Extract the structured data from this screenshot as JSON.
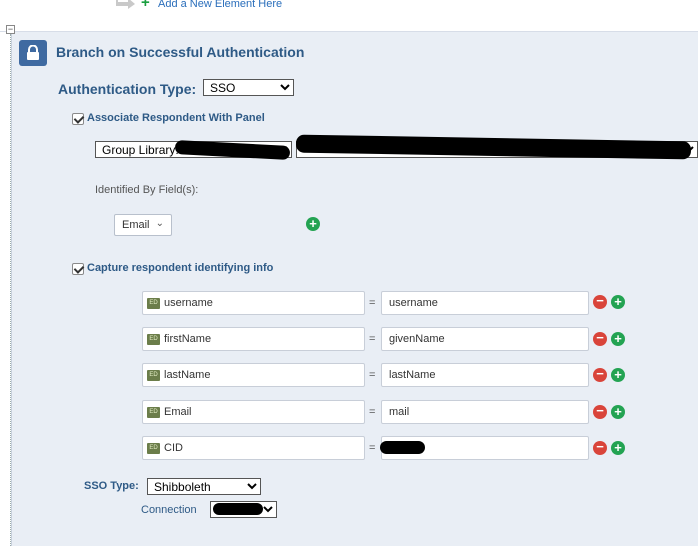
{
  "top": {
    "add_element_label": "Add a New Element Here"
  },
  "collapse_glyph": "−",
  "branch": {
    "title": "Branch on Successful Authentication",
    "auth_type_label": "Authentication Type:",
    "auth_type_value": "SSO",
    "associate_label": "Associate Respondent With Panel",
    "associate_checked": true,
    "group_library_text": "Group Library:",
    "identified_label": "Identified By Field(s):",
    "identified_field": "Email",
    "capture_label": "Capture respondent identifying info",
    "capture_checked": true,
    "mappings": [
      {
        "left": "username",
        "right": "username"
      },
      {
        "left": "firstName",
        "right": "givenName"
      },
      {
        "left": "lastName",
        "right": "lastName"
      },
      {
        "left": "Email",
        "right": "mail"
      },
      {
        "left": "CID",
        "right": ""
      }
    ],
    "equals": "=",
    "sso_type_label": "SSO Type:",
    "sso_type_value": "Shibboleth",
    "connection_label": "Connection"
  },
  "colors": {
    "accent": "#2e5a86",
    "panel_bg": "#e9eef5",
    "add_green": "#23a352",
    "remove_red": "#d9443a",
    "lock_bg": "#3f6aa1"
  },
  "icons": {
    "lock": "lock-icon",
    "add": "plus-circle-icon",
    "remove": "minus-circle-icon",
    "field": "embedded-data-icon",
    "arrow": "arrow-icon"
  }
}
